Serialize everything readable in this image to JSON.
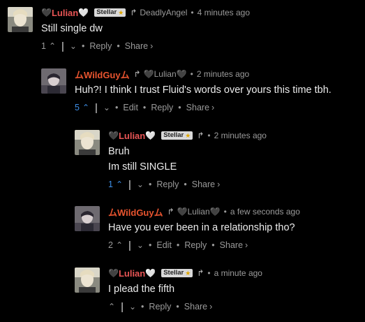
{
  "actions": {
    "edit": "Edit",
    "reply": "Reply",
    "share": "Share",
    "share_arrow": "›",
    "bullet": "•",
    "divider": "|"
  },
  "icons": {
    "upvote": "⌃",
    "downvote": "⌄",
    "reply_arrow": "↱",
    "heart_dark": "🖤",
    "heart_light": "🤍",
    "star": "★"
  },
  "comments": [
    {
      "author": "Lulian",
      "badge": "Stellar",
      "reply_to": "DeadlyAngel",
      "time": "4 minutes ago",
      "text": [
        "Still single dw"
      ],
      "upvotes": "1"
    },
    {
      "author": "ムWildGuyム",
      "reply_to": "Lulian",
      "time": "2 minutes ago",
      "text": [
        "Huh?! I think I trust Fluid's words over yours this time tbh."
      ],
      "upvotes": "5"
    },
    {
      "author": "Lulian",
      "badge": "Stellar",
      "time": "2 minutes ago",
      "text": [
        "Bruh",
        "Im still SINGLE"
      ],
      "upvotes": "1"
    },
    {
      "author": "ムWildGuyム",
      "reply_to": "Lulian",
      "time": "a few seconds ago",
      "text": [
        "Have you ever been in a relationship tho?"
      ],
      "upvotes": "2"
    },
    {
      "author": "Lulian",
      "badge": "Stellar",
      "time": "a minute ago",
      "text": [
        "I plead the fifth"
      ],
      "upvotes": ""
    }
  ],
  "colors": {
    "background": "#000000",
    "author_red": "#e85555",
    "author_orange": "#e8542f",
    "upvoted_blue": "#3d8ee6",
    "meta_gray": "#9a9a9a"
  }
}
